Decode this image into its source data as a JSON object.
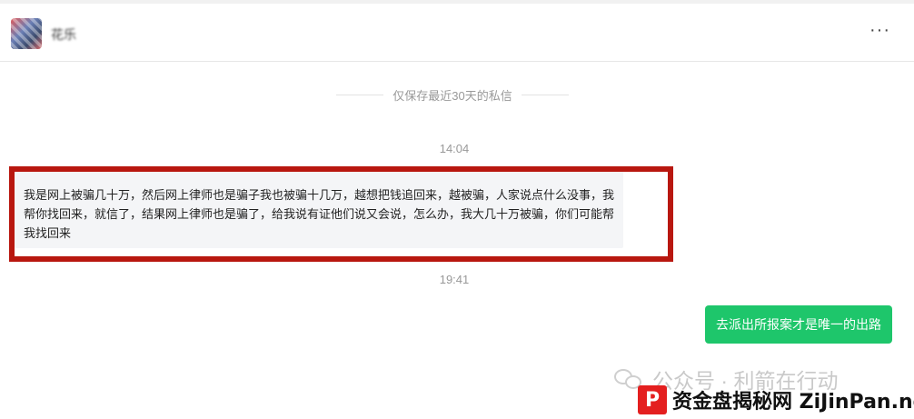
{
  "header": {
    "contact_name": "花乐",
    "more_label": "···"
  },
  "notice": "仅保存最近30天的私信",
  "messages": [
    {
      "time": "14:04",
      "text": "我是网上被骗几十万，然后网上律师也是骗子我也被骗十几万，越想把钱追回来，越被骗，人家说点什么没事，我帮你找回来，就信了，结果网上律师也是骗了，给我说有证他们说又会说，怎么办，我大几十万被骗，你们可能帮我找回来"
    },
    {
      "time": "19:41",
      "text": "去派出所报案才是唯一的出路"
    }
  ],
  "watermark": "公众号 · 利箭在行动",
  "brand": {
    "logo": "P",
    "text": "资金盘揭秘网 ZiJinPan.net"
  },
  "colors": {
    "highlight": "#b8170f",
    "outgoing_bubble": "#1ec66b",
    "incoming_bubble": "#f4f5f7",
    "brand_red": "#e41f1f"
  }
}
